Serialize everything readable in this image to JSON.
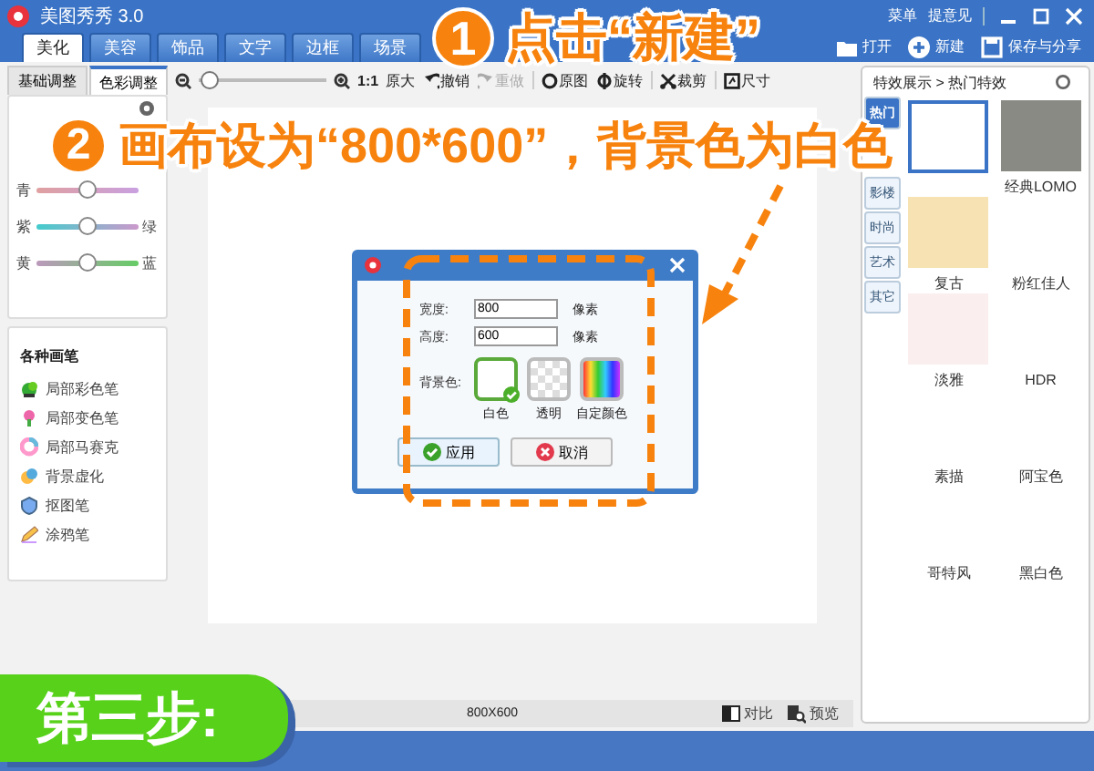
{
  "window": {
    "title": "美图秀秀 3.0",
    "links": [
      "菜单",
      "提意见"
    ]
  },
  "tabs": [
    {
      "label": "美化",
      "selected": true
    },
    {
      "label": "美容",
      "selected": false
    },
    {
      "label": "饰品",
      "selected": false
    },
    {
      "label": "文字",
      "selected": false
    },
    {
      "label": "边框",
      "selected": false
    },
    {
      "label": "场景",
      "selected": false
    }
  ],
  "actions": [
    "打开",
    "新建",
    "保存与分享"
  ],
  "left_panel": {
    "tabs": [
      {
        "label": "基础调整",
        "selected": false
      },
      {
        "label": "色彩调整",
        "selected": true
      }
    ],
    "sliders": [
      {
        "left": "青",
        "level": 0.5
      },
      {
        "left": "紫",
        "right": "绿",
        "level": 0.5
      },
      {
        "left": "黄",
        "right": "蓝",
        "level": 0.5
      }
    ],
    "brushes": {
      "title": "各种画笔",
      "items": [
        "局部彩色笔",
        "局部变色笔",
        "局部马赛克",
        "背景虚化",
        "抠图笔",
        "涂鸦笔"
      ]
    }
  },
  "toolbar": {
    "zoom": {
      "level": 0.02
    },
    "zoom_ratio": "1:1",
    "zoom_text": "原大",
    "tools": [
      {
        "label": "撤销",
        "disabled": false
      },
      {
        "label": "重做",
        "disabled": true
      },
      {
        "label": "原图",
        "disabled": false
      },
      {
        "label": "旋转",
        "disabled": false
      },
      {
        "label": "裁剪",
        "disabled": false
      },
      {
        "label": "尺寸",
        "disabled": false
      }
    ]
  },
  "dialog": {
    "fields": [
      {
        "label": "宽度:",
        "value": "800",
        "unit": "像素"
      },
      {
        "label": "高度:",
        "value": "600",
        "unit": "像素"
      }
    ],
    "background_label": "背景色:",
    "swatches": [
      {
        "label": "白色",
        "kind": "white",
        "selected": true
      },
      {
        "label": "透明",
        "kind": "transparent",
        "selected": false
      },
      {
        "label": "自定颜色",
        "kind": "custom",
        "selected": false
      }
    ],
    "buttons": [
      "应用",
      "取消"
    ]
  },
  "effects": {
    "breadcrumb": "特效展示 > 热门特效",
    "categories": [
      {
        "label": "热门",
        "selected": true
      },
      {
        "label": "影楼",
        "selected": false
      },
      {
        "label": "时尚",
        "selected": false
      },
      {
        "label": "艺术",
        "selected": false
      },
      {
        "label": "其它",
        "selected": false
      }
    ],
    "items": [
      {
        "selected": true,
        "color": "#ffffff"
      },
      {
        "label": "经典LOMO",
        "selected": false,
        "color": "#8a8a84"
      },
      {
        "label": "复古",
        "selected": false,
        "color": "#f6e2b2"
      },
      {
        "label": "粉红佳人",
        "selected": false
      },
      {
        "label": "淡雅",
        "selected": false,
        "color": "#fbeeee"
      },
      {
        "label": "HDR",
        "selected": false
      },
      {
        "label": "素描",
        "selected": false
      },
      {
        "label": "阿宝色",
        "selected": false
      },
      {
        "label": "哥特风",
        "selected": false
      },
      {
        "label": "黑白色",
        "selected": false
      }
    ]
  },
  "status_bar": {
    "size": "800X600",
    "buttons": [
      "对比",
      "预览"
    ]
  },
  "annotations": {
    "steps": [
      {
        "number": "1",
        "text": "点击“新建”"
      },
      {
        "number": "2",
        "text": "画布设为“800*600”，背景色为白色"
      }
    ],
    "badge": "第三步:"
  }
}
